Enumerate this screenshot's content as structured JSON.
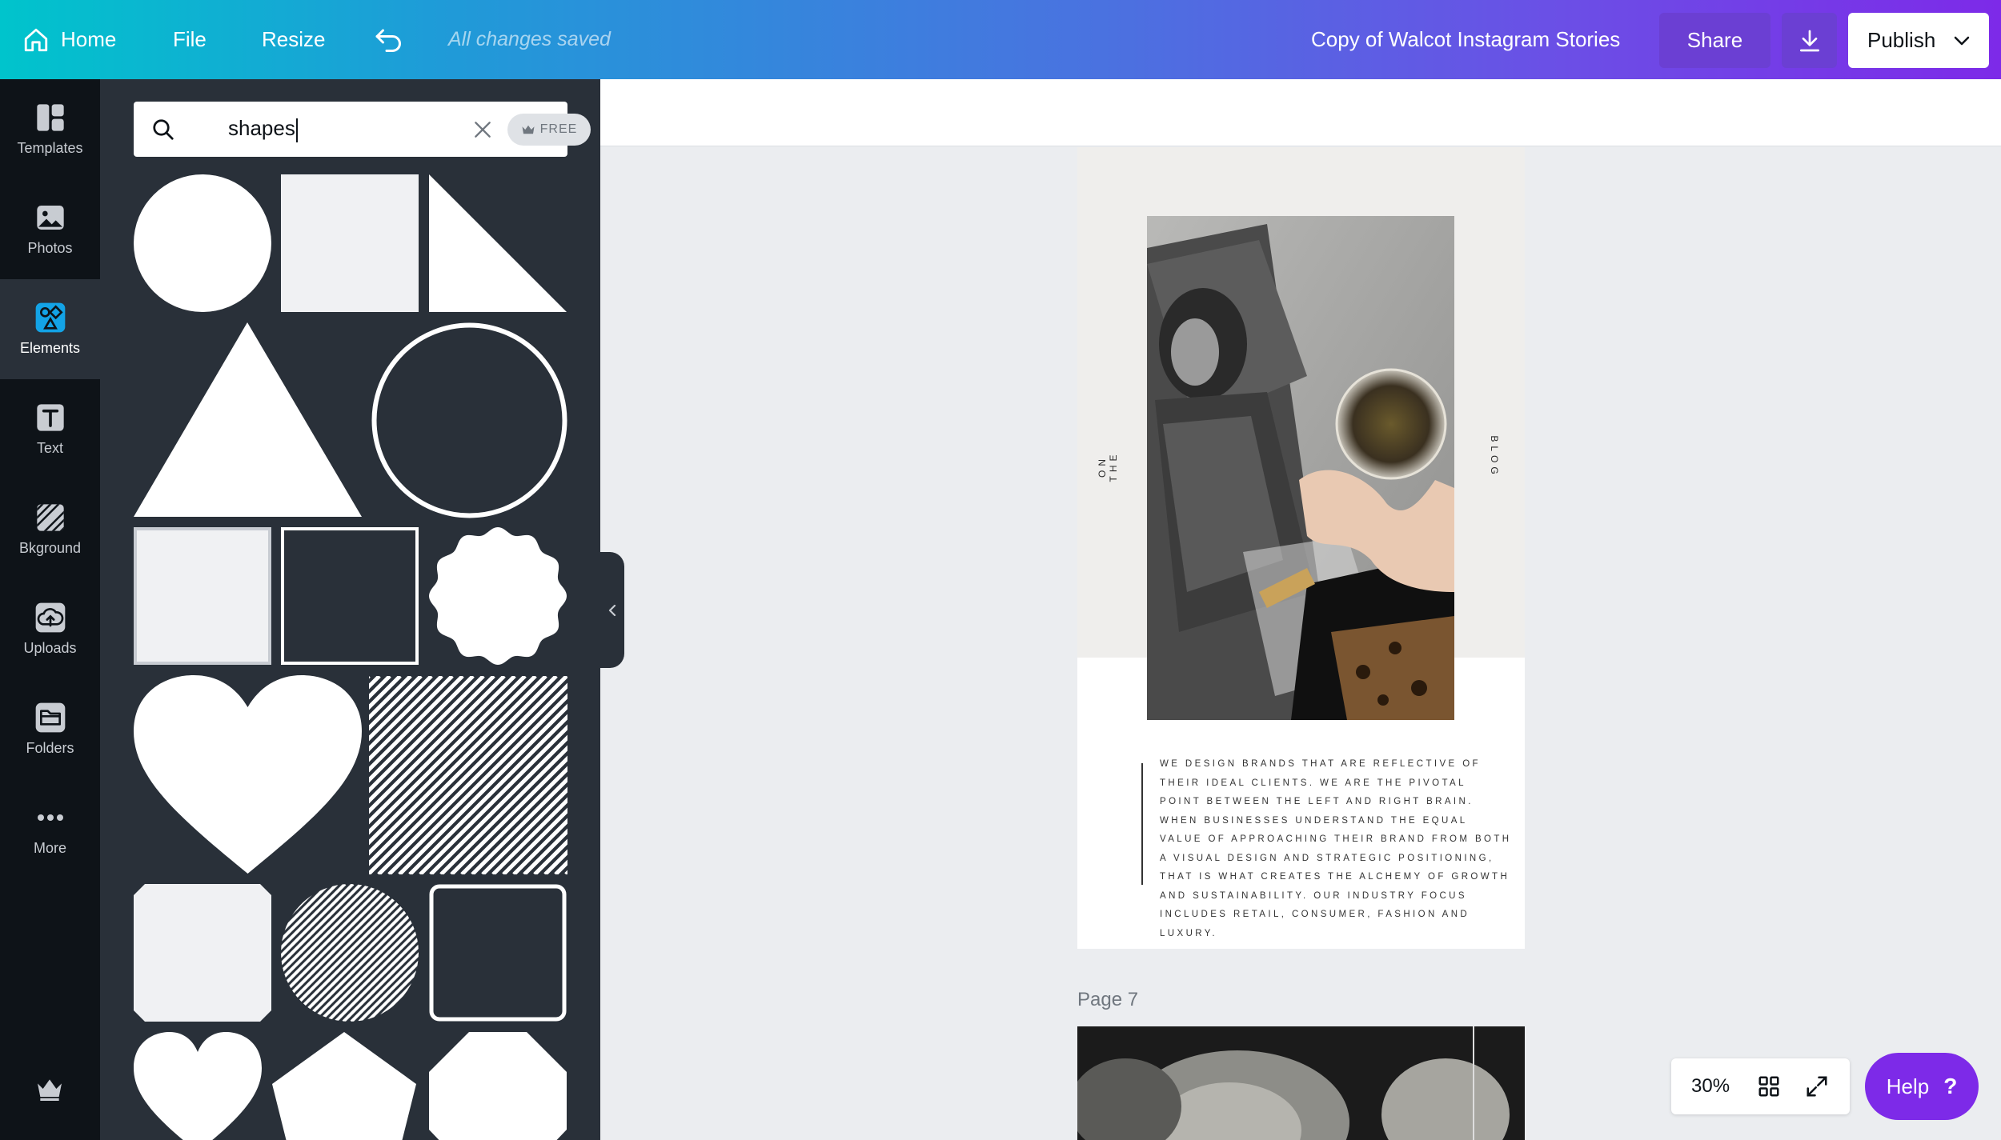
{
  "topbar": {
    "home_label": "Home",
    "file_label": "File",
    "resize_label": "Resize",
    "status": "All changes saved",
    "document_title": "Copy of Walcot Instagram Stories",
    "share_label": "Share",
    "publish_label": "Publish",
    "gradient_start": "#00c4cc",
    "gradient_end": "#7d2ae8"
  },
  "rail": {
    "items": [
      {
        "label": "Templates",
        "icon": "templates-icon"
      },
      {
        "label": "Photos",
        "icon": "photos-icon"
      },
      {
        "label": "Elements",
        "icon": "elements-icon",
        "active": true
      },
      {
        "label": "Text",
        "icon": "text-icon"
      },
      {
        "label": "Bkground",
        "icon": "background-icon"
      },
      {
        "label": "Uploads",
        "icon": "uploads-icon"
      },
      {
        "label": "Folders",
        "icon": "folders-icon"
      },
      {
        "label": "More",
        "icon": "more-icon"
      }
    ]
  },
  "search": {
    "value": "shapes",
    "filter_badge": "FREE"
  },
  "shapes": [
    "circle",
    "square-light",
    "right-triangle",
    "triangle",
    "circle-outline",
    "square-gray-outline",
    "square-dark-outline",
    "scalloped-badge",
    "heart",
    "striped-square",
    "octagon-rounded",
    "striped-circle",
    "square-rounded-outline",
    "heart-small",
    "pentagon",
    "octagon"
  ],
  "design": {
    "vertical_left": "ON THE",
    "vertical_right": "BLOG",
    "body": "We design brands that are reflective of their ideal clients. We are the pivotal point between the left and right brain. When businesses understand the equal value of approaching their brand from both a visual design and strategic positioning, that is what creates the alchemy of growth and sustainability. Our industry focus includes retail, consumer, fashion and luxury."
  },
  "next_page_label": "Page 7",
  "zoom": {
    "value": "30%"
  },
  "help": {
    "label": "Help",
    "glyph": "?"
  }
}
